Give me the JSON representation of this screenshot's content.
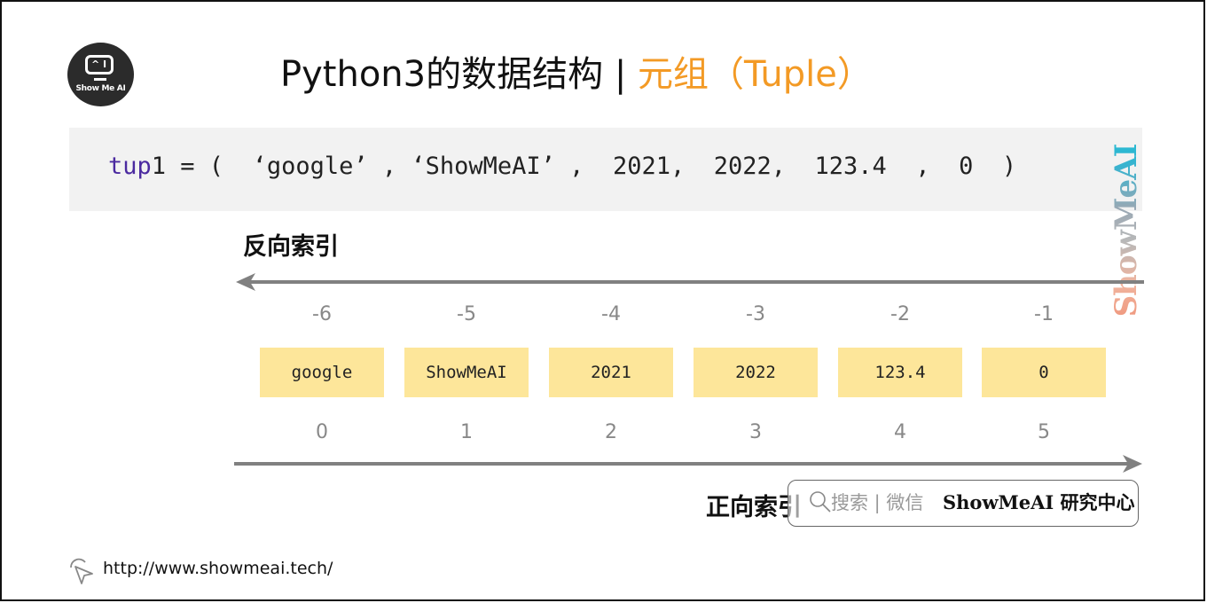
{
  "logo": {
    "screen_glyph": "^ I",
    "text": "Show Me AI"
  },
  "title": {
    "main": "Python3的数据结构 | ",
    "accent": "元组（Tuple）"
  },
  "code": {
    "keyword": "tup",
    "rest": "1 = (  ‘google’ , ‘ShowMeAI’ ,  2021,  2022,  123.4  ,  0  )"
  },
  "watermark": "ShowMeAI",
  "reverse_index": {
    "label": "反向索引",
    "values": [
      "-6",
      "-5",
      "-4",
      "-3",
      "-2",
      "-1"
    ]
  },
  "elements": [
    "google",
    "ShowMeAI",
    "2021",
    "2022",
    "123.4",
    "0"
  ],
  "forward_index": {
    "label": "正向索引",
    "values": [
      "0",
      "1",
      "2",
      "3",
      "4",
      "5"
    ]
  },
  "search_badge": {
    "prefix": "搜索 | 微信",
    "brand_latin": "ShowMeAI",
    "brand_cn": " 研究中心"
  },
  "footer": {
    "url": "http://www.showmeai.tech/"
  },
  "colors": {
    "accent": "#f39a25",
    "cell_fill": "#fde69a",
    "arrow": "#808080",
    "keyword": "#4b2aa0"
  }
}
